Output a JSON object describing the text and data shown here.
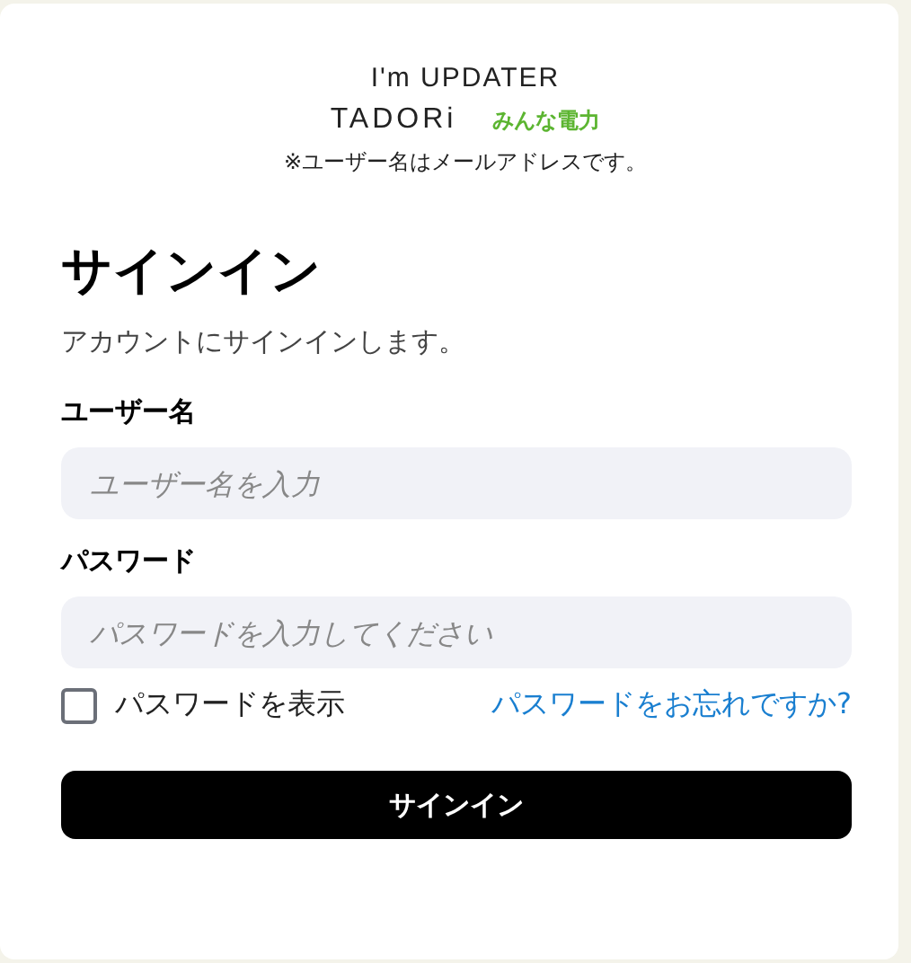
{
  "logos": [
    {
      "kind": "updater",
      "text": "I'm UPDATER"
    },
    {
      "kind": "tadori",
      "text": "TADORi"
    },
    {
      "kind": "minden",
      "text": "みんな電力"
    }
  ],
  "note": "※ユーザー名はメールアドレスです。",
  "title": "サインイン",
  "subtitle": "アカウントにサインインします。",
  "fields": [
    {
      "label": "ユーザー名",
      "placeholder": "ユーザー名を入力"
    },
    {
      "label": "パスワード",
      "placeholder": "パスワードを入力してください"
    }
  ],
  "show_password": {
    "label": "パスワードを表示",
    "checked": false
  },
  "forgot_link": "パスワードをお忘れですか?",
  "submit": "サインイン"
}
